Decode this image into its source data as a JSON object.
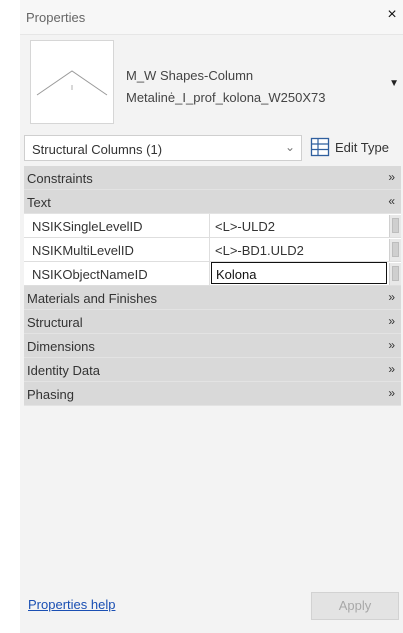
{
  "window": {
    "title": "Properties",
    "close_glyph": "×"
  },
  "type_selector": {
    "family": "M_W Shapes-Column",
    "type": "Metalinė_I_prof_kolona_W250X73",
    "thumbnail_icon": "column-profile-icon",
    "arrow_glyph": "▼"
  },
  "filter": {
    "label": "Structural Columns (1)",
    "chevron": "⌄",
    "edit_type_label": "Edit Type",
    "edit_type_icon": "edit-type-icon"
  },
  "groups": {
    "constraints": {
      "label": "Constraints",
      "chevron": "»"
    },
    "text": {
      "label": "Text",
      "chevron": "«",
      "rows": [
        {
          "name": "NSIKSingleLevelID",
          "value": "<L>-ULD2"
        },
        {
          "name": "NSIKMultiLevelID",
          "value": "<L>-BD1.ULD2"
        },
        {
          "name": "NSIKObjectNameID",
          "value": "Kolona"
        }
      ]
    },
    "materials": {
      "label": "Materials and Finishes",
      "chevron": "»"
    },
    "structural": {
      "label": "Structural",
      "chevron": "»"
    },
    "dimensions": {
      "label": "Dimensions",
      "chevron": "»"
    },
    "identity": {
      "label": "Identity Data",
      "chevron": "»"
    },
    "phasing": {
      "label": "Phasing",
      "chevron": "»"
    }
  },
  "footer": {
    "help_link": "Properties help",
    "apply_label": "Apply"
  }
}
